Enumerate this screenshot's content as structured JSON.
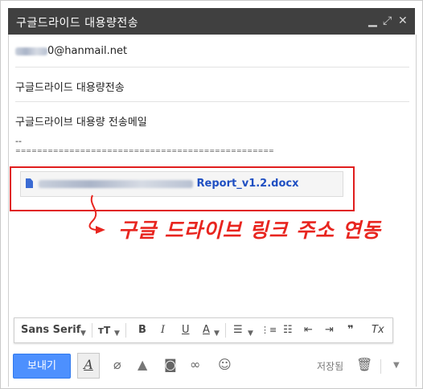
{
  "window": {
    "title": "구글드라이드 대용량전송",
    "minimize_icon": "minimize-icon",
    "expand_icon": "expand-icon",
    "close_icon": "close-icon"
  },
  "compose": {
    "to_suffix": "0@hanmail.net",
    "subject": "구글드라이드 대용량전송",
    "body_line": "구글드라이브 대용량 전송메일",
    "signature_dash": "--",
    "divider_text": "================================================",
    "attachment": {
      "name_visible": "Report_v1.2.docx",
      "icon": "doc-icon"
    }
  },
  "annotation": {
    "text": "구글 드라이브 링크 주소 연동",
    "color": "#e8251f"
  },
  "format_toolbar": {
    "font": "Sans Serif",
    "size_label": "тT",
    "bold": "B",
    "italic": "I",
    "underline": "U",
    "text_color": "A",
    "quote": "❞",
    "clear": "Tx"
  },
  "bottom_bar": {
    "send_label": "보내기",
    "saved_label": "저장됨",
    "accent": "#4d90fe"
  }
}
